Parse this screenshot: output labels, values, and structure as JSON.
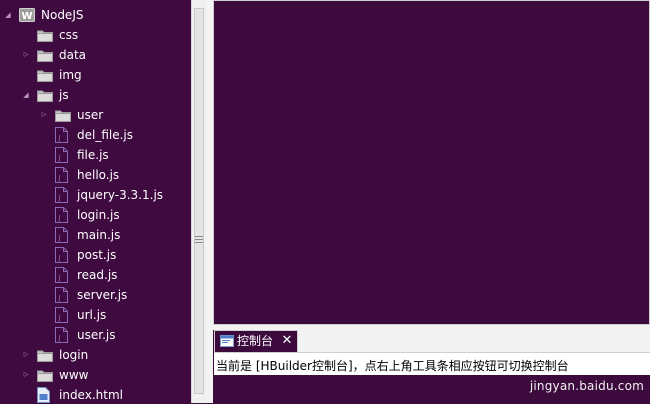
{
  "project_tree": {
    "items": [
      {
        "label": "NodeJS",
        "kind": "project",
        "depth": 0,
        "twisty": "expanded"
      },
      {
        "label": "css",
        "kind": "folder",
        "depth": 1,
        "twisty": "none"
      },
      {
        "label": "data",
        "kind": "folder",
        "depth": 1,
        "twisty": "collapsed"
      },
      {
        "label": "img",
        "kind": "folder",
        "depth": 1,
        "twisty": "none"
      },
      {
        "label": "js",
        "kind": "folder",
        "depth": 1,
        "twisty": "expanded"
      },
      {
        "label": "user",
        "kind": "folder",
        "depth": 2,
        "twisty": "collapsed"
      },
      {
        "label": "del_file.js",
        "kind": "file",
        "depth": 2,
        "twisty": "none"
      },
      {
        "label": "file.js",
        "kind": "file",
        "depth": 2,
        "twisty": "none"
      },
      {
        "label": "hello.js",
        "kind": "file",
        "depth": 2,
        "twisty": "none"
      },
      {
        "label": "jquery-3.3.1.js",
        "kind": "file",
        "depth": 2,
        "twisty": "none"
      },
      {
        "label": "login.js",
        "kind": "file",
        "depth": 2,
        "twisty": "none"
      },
      {
        "label": "main.js",
        "kind": "file",
        "depth": 2,
        "twisty": "none"
      },
      {
        "label": "post.js",
        "kind": "file",
        "depth": 2,
        "twisty": "none"
      },
      {
        "label": "read.js",
        "kind": "file",
        "depth": 2,
        "twisty": "none"
      },
      {
        "label": "server.js",
        "kind": "file",
        "depth": 2,
        "twisty": "none"
      },
      {
        "label": "url.js",
        "kind": "file",
        "depth": 2,
        "twisty": "none"
      },
      {
        "label": "user.js",
        "kind": "file",
        "depth": 2,
        "twisty": "none"
      },
      {
        "label": "login",
        "kind": "folder",
        "depth": 1,
        "twisty": "collapsed"
      },
      {
        "label": "www",
        "kind": "folder",
        "depth": 1,
        "twisty": "collapsed"
      },
      {
        "label": "index.html",
        "kind": "html",
        "depth": 1,
        "twisty": "none"
      }
    ]
  },
  "console": {
    "tab_label": "控制台",
    "close_glyph": "✕",
    "message": "当前是 [HBuilder控制台]，点右上角工具条相应按钮可切换控制台"
  },
  "watermark": "jingyan.baidu.com",
  "colors": {
    "background": "#3d0a3d",
    "folder": "#c8c8c8",
    "file_icon": "#8d6ab8",
    "chrome": "#f3f3f3"
  }
}
